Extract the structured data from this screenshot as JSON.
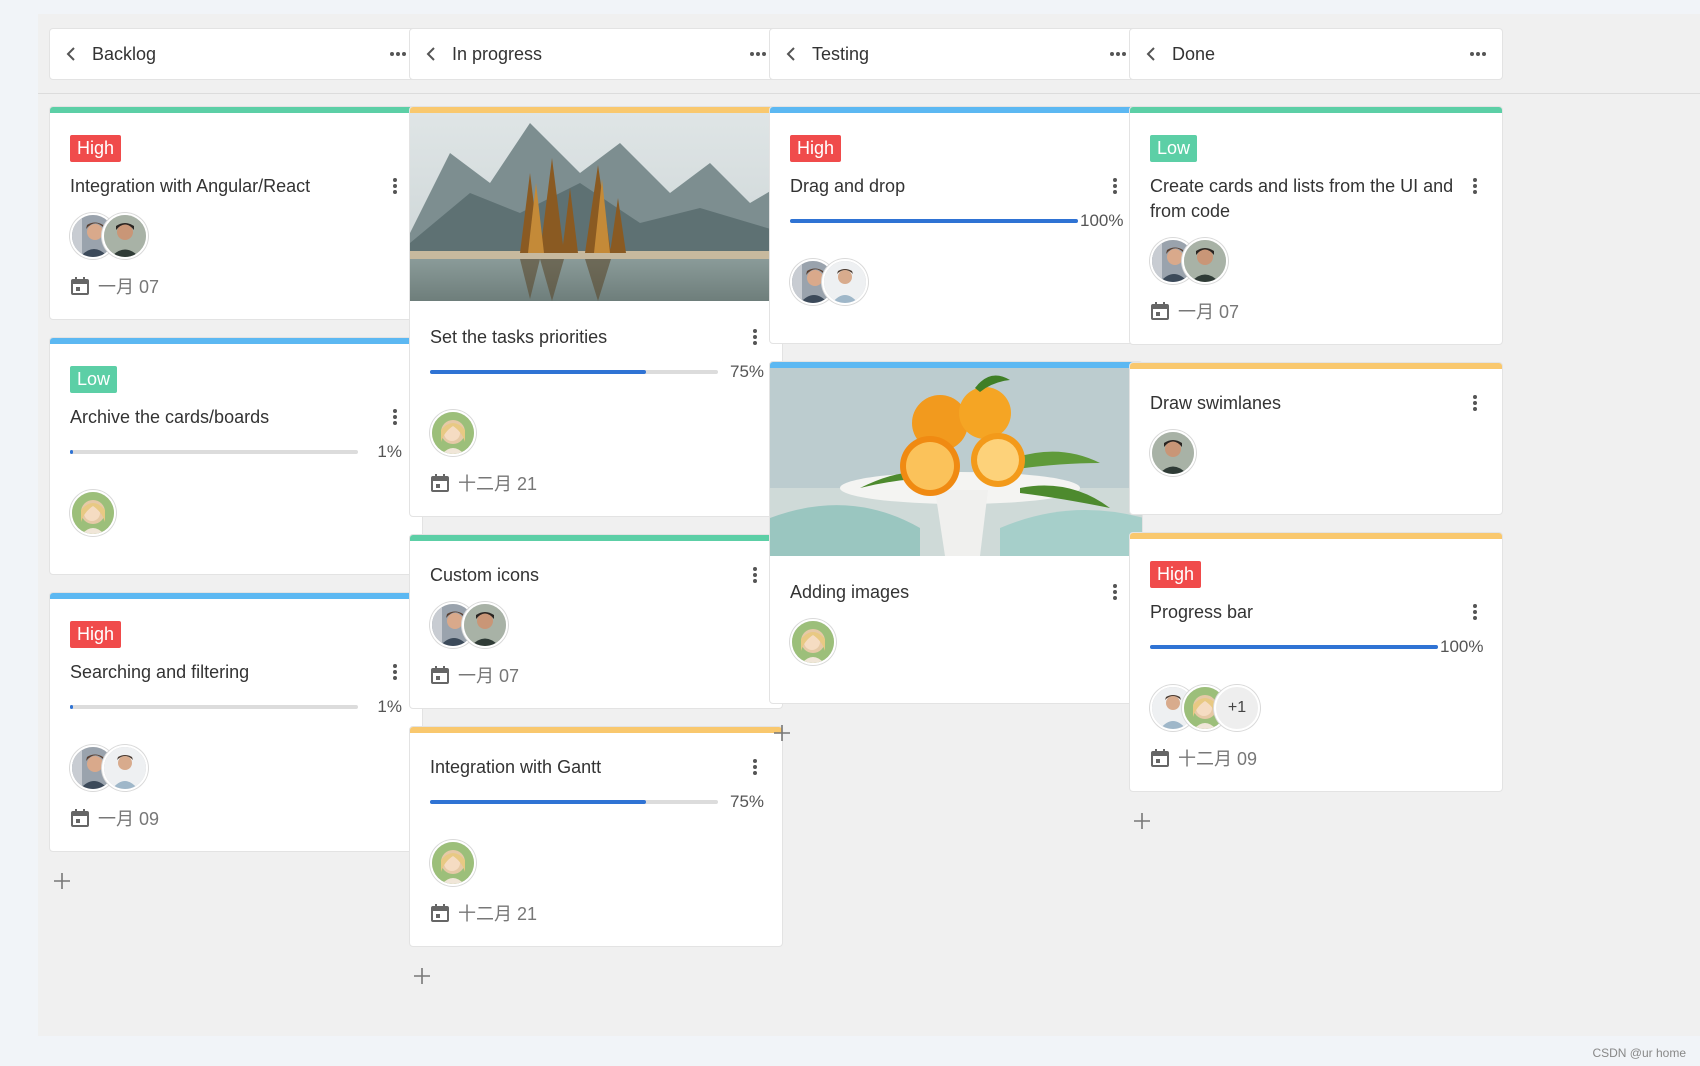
{
  "colors": {
    "green": "#5ccfa6",
    "blue": "#5cb8f2",
    "orange": "#f9c86e",
    "high": "#f04b4b",
    "low": "#5ccfa6",
    "progress": "#2f73d4"
  },
  "columns": [
    {
      "title": "Backlog",
      "cards": [
        {
          "stripe": "green",
          "priority": "High",
          "title": "Integration with Angular/React",
          "avatars": [
            "male-a",
            "male-b"
          ],
          "date": "一月 07"
        },
        {
          "stripe": "blue",
          "priority": "Low",
          "title": "Archive the cards/boards",
          "progress": 1,
          "progress_label": "1%",
          "avatars": [
            "female-a"
          ]
        },
        {
          "stripe": "blue",
          "priority": "High",
          "title": "Searching and filtering",
          "progress": 1,
          "progress_label": "1%",
          "avatars": [
            "male-a",
            "male-c"
          ],
          "date": "一月 09"
        }
      ]
    },
    {
      "title": "In progress",
      "cards": [
        {
          "stripe": "orange",
          "image": "mountain-lake-image",
          "title": "Set the tasks priorities",
          "progress": 75,
          "progress_label": "75%",
          "avatars": [
            "female-a"
          ],
          "date": "十二月 21"
        },
        {
          "stripe": "green",
          "title": "Custom icons",
          "avatars": [
            "male-a",
            "male-b"
          ],
          "date": "一月 07"
        },
        {
          "stripe": "orange",
          "title": "Integration with Gantt",
          "progress": 75,
          "progress_label": "75%",
          "avatars": [
            "female-a"
          ],
          "date": "十二月 21"
        }
      ]
    },
    {
      "title": "Testing",
      "cards": [
        {
          "stripe": "blue",
          "priority": "High",
          "title": "Drag and drop",
          "progress": 100,
          "progress_label": "100%",
          "avatars": [
            "male-a",
            "male-c"
          ]
        },
        {
          "stripe": "blue",
          "image": "oranges-image",
          "title": "Adding images",
          "avatars": [
            "female-a"
          ]
        }
      ]
    },
    {
      "title": "Done",
      "cards": [
        {
          "stripe": "green",
          "priority": "Low",
          "title": "Create cards and lists from the UI and from code",
          "avatars": [
            "male-a",
            "male-b"
          ],
          "date": "一月 07"
        },
        {
          "stripe": "orange",
          "title": "Draw swimlanes",
          "avatars": [
            "male-b"
          ]
        },
        {
          "stripe": "orange",
          "priority": "High",
          "title": "Progress bar",
          "progress": 100,
          "progress_label": "100%",
          "avatars": [
            "male-c",
            "female-a"
          ],
          "more": "+1",
          "date": "十二月 09"
        }
      ]
    }
  ],
  "watermark": "CSDN @ur home"
}
